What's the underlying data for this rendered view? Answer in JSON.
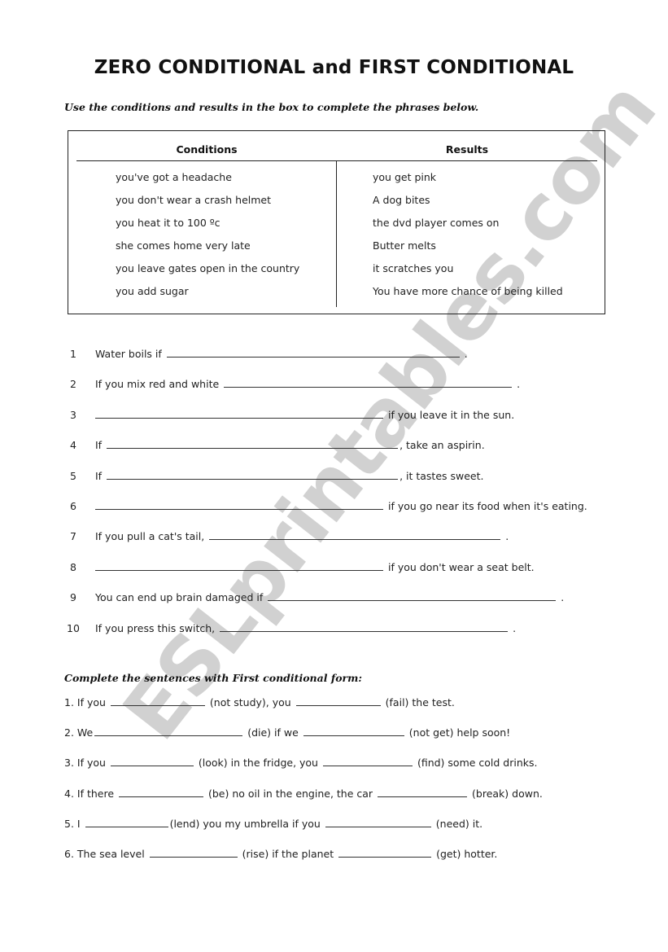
{
  "title": "ZERO CONDITIONAL and FIRST CONDITIONAL",
  "instructions_1": "Use the conditions and results in the box to complete the phrases below.",
  "box": {
    "conditions_header": "Conditions",
    "results_header": "Results",
    "conditions": [
      "you've got a headache",
      "you don't wear a crash helmet",
      "you heat it to 100 ºc",
      "she comes home very late",
      "you leave gates open in the country",
      "you add sugar"
    ],
    "results": [
      "you get pink",
      "A dog bites",
      "the dvd player comes on",
      "Butter melts",
      "it scratches you",
      "You have more chance of being killed"
    ]
  },
  "exercise_1": [
    {
      "num": "1",
      "before": "Water boils if",
      "after": "."
    },
    {
      "num": "2",
      "before": "If you mix red and white",
      "after": "."
    },
    {
      "num": "3",
      "before": "",
      "after": "if you leave it in the sun."
    },
    {
      "num": "4",
      "before": "If",
      "after": ", take an aspirin."
    },
    {
      "num": "5",
      "before": "If",
      "after": ", it tastes sweet."
    },
    {
      "num": "6",
      "before": "",
      "after": "if you go near its food when it's eating."
    },
    {
      "num": "7",
      "before": "If you pull a cat's tail,",
      "after": "."
    },
    {
      "num": "8",
      "before": "",
      "after": "if you don't wear a seat belt."
    },
    {
      "num": "9",
      "before": "You can end up brain damaged if",
      "after": "."
    },
    {
      "num": "10",
      "before": "If you press this switch,",
      "after": "."
    }
  ],
  "instructions_2": "Complete the sentences with First conditional form:",
  "exercise_2": [
    {
      "a": "1. If you",
      "b": "(not study), you",
      "c": "(fail) the test."
    },
    {
      "a": "2. We",
      "b": "(die) if we",
      "c": "(not get) help soon!"
    },
    {
      "a": "3. If you",
      "b": "(look) in the fridge, you",
      "c": "(find) some cold drinks."
    },
    {
      "a": "4. If there",
      "b": "(be) no oil in the engine, the car",
      "c": "(break) down."
    },
    {
      "a": "5. I",
      "b": "(lend) you my umbrella if you",
      "c": "(need) it."
    },
    {
      "a": "6. The sea level",
      "b": "(rise) if the planet",
      "c": "(get) hotter."
    }
  ],
  "watermark": "ESLprintables.com"
}
